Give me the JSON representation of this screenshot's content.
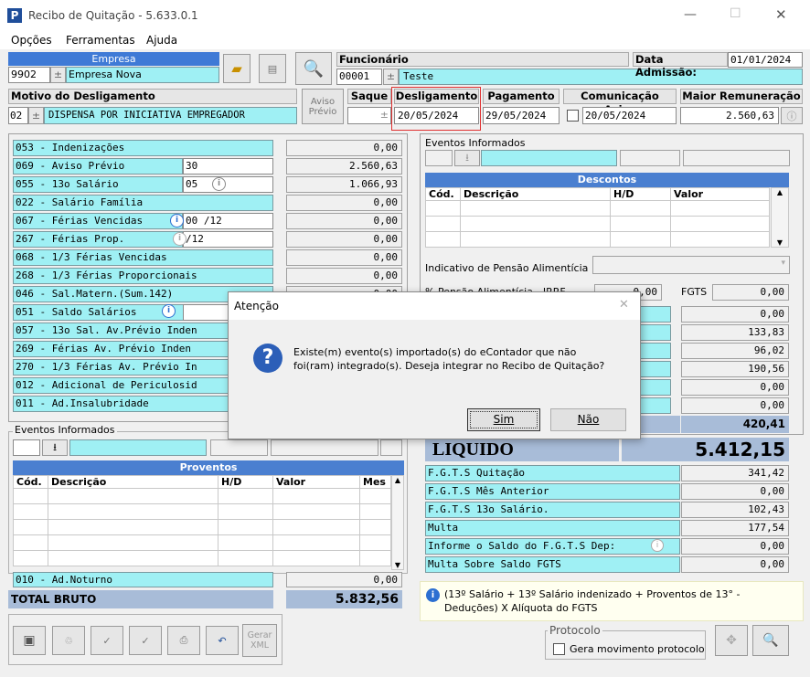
{
  "window": {
    "title": "Recibo de Quitação - 5.633.0.1",
    "minimize": "—",
    "maximize": "☐",
    "close": "✕"
  },
  "menu": [
    "Opções",
    "Ferramentas",
    "Ajuda"
  ],
  "empresa": {
    "label": "Empresa",
    "code": "9902",
    "name": "Empresa Nova"
  },
  "funcionario": {
    "label": "Funcionário",
    "code": "00001",
    "name": "Teste"
  },
  "admissao": {
    "label": "Data Admissão:",
    "value": "01/01/2024"
  },
  "motivo": {
    "label": "Motivo do Desligamento",
    "code": "02",
    "value": "DISPENSA POR INICIATIVA EMPREGADOR"
  },
  "aviso": {
    "line1": "Aviso",
    "line2": "Prévio"
  },
  "saque": {
    "label": "Saque"
  },
  "desligamento": {
    "label": "Desligamento",
    "value": "20/05/2024"
  },
  "pagamento": {
    "label": "Pagamento",
    "value": "29/05/2024"
  },
  "comunicacao": {
    "label": "Comunicação Aviso",
    "value": "20/05/2024"
  },
  "maior": {
    "label": "Maior Remuneração",
    "value": "2.560,63"
  },
  "left_items": [
    {
      "label": "053 - Indenizações",
      "mid": "",
      "val": "0,00"
    },
    {
      "label": "069 - Aviso Prévio",
      "mid": "30",
      "val": "2.560,63"
    },
    {
      "label": "055 - 13o Salário",
      "mid": "05",
      "val": "1.066,93"
    },
    {
      "label": "022 - Salário Família",
      "mid": "",
      "val": "0,00"
    },
    {
      "label": "067 - Férias Vencidas",
      "mid": "00 /12",
      "val": "0,00"
    },
    {
      "label": "267 - Férias Prop.",
      "mid": "/12",
      "val": "0,00"
    },
    {
      "label": "068 - 1/3 Férias Vencidas",
      "mid": "",
      "val": "0,00"
    },
    {
      "label": "268 - 1/3 Férias Proporcionais",
      "mid": "",
      "val": "0,00"
    },
    {
      "label": "046 - Sal.Matern.(Sum.142)",
      "mid": "",
      "val": "0,00"
    },
    {
      "label": "051 - Saldo Salários",
      "mid": "0,00",
      "val": ""
    },
    {
      "label": "057 - 13o Sal. Av.Prévio Inden",
      "mid": "",
      "val": ""
    },
    {
      "label": "269 - Férias  Av. Prévio Inden",
      "mid": "",
      "val": ""
    },
    {
      "label": "270 - 1/3 Férias Av. Prévio In",
      "mid": "",
      "val": ""
    },
    {
      "label": "012 - Adicional de Periculosid",
      "mid": "",
      "val": ""
    },
    {
      "label": "011 - Ad.Insalubridade",
      "mid": "",
      "val": ""
    }
  ],
  "eventos_informados": "Eventos Informados",
  "proventos": {
    "title": "Proventos",
    "cols": [
      "Cód.",
      "Descrição",
      "H/D",
      "Valor",
      "Mes"
    ]
  },
  "ad_noturno": {
    "label": "010 - Ad.Noturno",
    "val": "0,00"
  },
  "total_bruto": {
    "label": "TOTAL BRUTO",
    "val": "5.832,56"
  },
  "descontos": {
    "title": "Descontos",
    "cols": [
      "Cód.",
      "Descrição",
      "H/D",
      "Valor"
    ]
  },
  "pensao": {
    "label": "Indicativo de Pensão Alimentícia",
    "pct_label": "% Pensão Alimentícia - IRRF",
    "pct_val": "0,00",
    "fgts_label": "FGTS",
    "fgts_val": "0,00"
  },
  "right_values": [
    "0,00",
    "133,83",
    "96,02",
    "190,56",
    "0,00",
    "0,00"
  ],
  "total_desc": "420,41",
  "liquido": {
    "label": "LIQUIDO",
    "val": "5.412,15"
  },
  "fgts_rows": [
    {
      "label": "F.G.T.S  Quitação",
      "val": "341,42"
    },
    {
      "label": "F.G.T.S  Mês Anterior",
      "val": "0,00"
    },
    {
      "label": "F.G.T.S  13o Salário.",
      "val": "102,43"
    },
    {
      "label": "Multa",
      "val": "177,54"
    },
    {
      "label": "Informe o Saldo do F.G.T.S Dep:",
      "val": "0,00"
    },
    {
      "label": "Multa Sobre Saldo FGTS",
      "val": "0,00"
    }
  ],
  "info_note": "(13º Salário + 13º Salário indenizado + Proventos de 13° - Deduções) X Alíquota do FGTS",
  "protocolo": {
    "label": "Protocolo",
    "checkbox": "Gera movimento protocolo"
  },
  "gerar_xml": {
    "line1": "Gerar",
    "line2": "XML"
  },
  "dialog": {
    "title": "Atenção",
    "message_l1": "Existe(m) evento(s) importado(s) do eContador que não",
    "message_l2": "foi(ram) integrado(s). Deseja integrar no Recibo de Quitação?",
    "yes": "Sim",
    "no": "Não",
    "close": "✕"
  },
  "colors": {
    "cyan": "#9ff0f4",
    "header_blue": "#4a7fd0",
    "highlight_red": "#e03030"
  }
}
